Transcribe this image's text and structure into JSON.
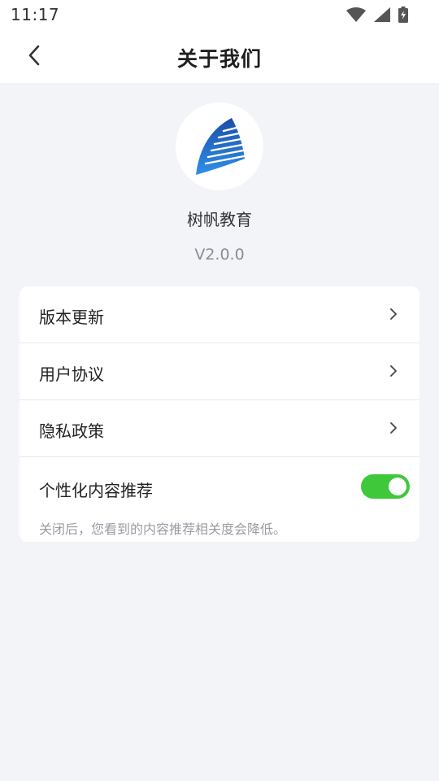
{
  "status_bar": {
    "time": "11:17",
    "icons": [
      "wifi-icon",
      "cellular-signal-icon",
      "battery-charging-icon"
    ]
  },
  "header": {
    "title": "关于我们",
    "back_icon": "chevron-left-icon"
  },
  "app": {
    "logo_icon": "sail-logo-icon",
    "name": "树帆教育",
    "version": "V2.0.0"
  },
  "menu": {
    "items": [
      {
        "label": "版本更新",
        "icon": "chevron-right-icon"
      },
      {
        "label": "用户协议",
        "icon": "chevron-right-icon"
      },
      {
        "label": "隐私政策",
        "icon": "chevron-right-icon"
      }
    ],
    "personalized": {
      "label": "个性化内容推荐",
      "enabled": true,
      "hint": "关闭后，您看到的内容推荐相关度会降低。"
    }
  },
  "colors": {
    "background": "#f3f4f8",
    "toggle_on": "#3ec83a",
    "logo_blue": "#1f6fd6"
  }
}
